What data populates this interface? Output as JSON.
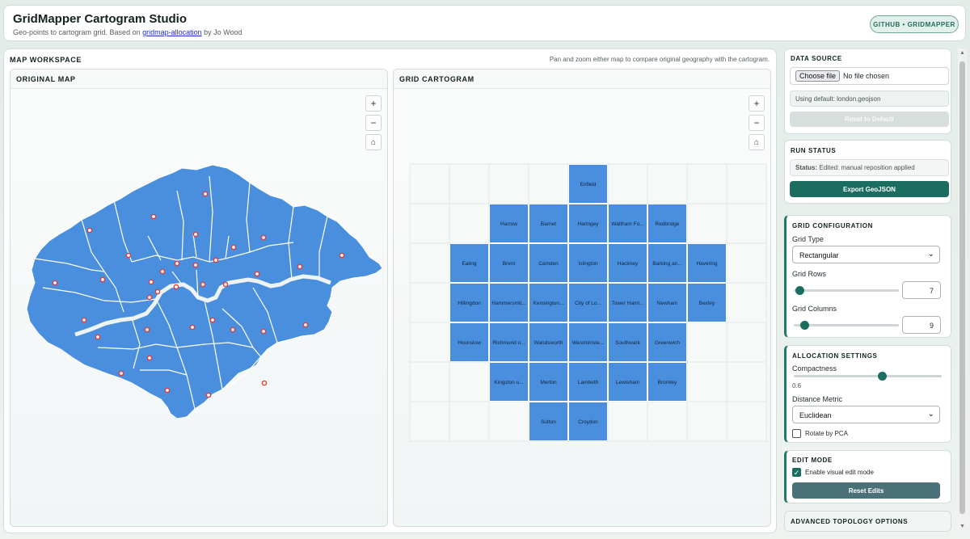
{
  "header": {
    "title": "GridMapper Cartogram Studio",
    "subtitle_prefix": "Geo-points to cartogram grid. Based on",
    "subtitle_link": "gridmap-allocation",
    "subtitle_suffix": "by Jo Wood",
    "github_button": "GITHUB • GRIDMAPPER"
  },
  "workspace": {
    "title": "MAP WORKSPACE",
    "hint": "Pan and zoom either map to compare original geography with the cartogram.",
    "original_panel_title": "ORIGINAL MAP",
    "grid_panel_title": "GRID CARTOGRAM",
    "zoom_in": "+",
    "zoom_out": "−",
    "reset_view": "⌂"
  },
  "colors": {
    "region_fill": "#4a8fde",
    "region_stroke": "#ffffff",
    "point_fill": "#ffffff",
    "point_ring": "#e03b3b",
    "cell_fill": "#4a8fde",
    "empty_cell": "#f7f9f9",
    "accent": "#1b6e5f"
  },
  "grid": {
    "rows": 7,
    "cols": 9,
    "cells": [
      {
        "row": 0,
        "col": 4,
        "label": "Enfield"
      },
      {
        "row": 1,
        "col": 2,
        "label": "Harrow"
      },
      {
        "row": 1,
        "col": 3,
        "label": "Barnet"
      },
      {
        "row": 1,
        "col": 4,
        "label": "Haringey"
      },
      {
        "row": 1,
        "col": 5,
        "label": "Waltham Fo..."
      },
      {
        "row": 1,
        "col": 6,
        "label": "Redbridge"
      },
      {
        "row": 2,
        "col": 1,
        "label": "Ealing"
      },
      {
        "row": 2,
        "col": 2,
        "label": "Brent"
      },
      {
        "row": 2,
        "col": 3,
        "label": "Camden"
      },
      {
        "row": 2,
        "col": 4,
        "label": "Islington"
      },
      {
        "row": 2,
        "col": 5,
        "label": "Hackney"
      },
      {
        "row": 2,
        "col": 6,
        "label": "Barking an..."
      },
      {
        "row": 2,
        "col": 7,
        "label": "Havering"
      },
      {
        "row": 3,
        "col": 1,
        "label": "Hillingdon"
      },
      {
        "row": 3,
        "col": 2,
        "label": "Hammersmit..."
      },
      {
        "row": 3,
        "col": 3,
        "label": "Kensington..."
      },
      {
        "row": 3,
        "col": 4,
        "label": "City of Lo..."
      },
      {
        "row": 3,
        "col": 5,
        "label": "Tower Haml..."
      },
      {
        "row": 3,
        "col": 6,
        "label": "Newham"
      },
      {
        "row": 3,
        "col": 7,
        "label": "Bexley"
      },
      {
        "row": 4,
        "col": 1,
        "label": "Hounslow"
      },
      {
        "row": 4,
        "col": 2,
        "label": "Richmond u..."
      },
      {
        "row": 4,
        "col": 3,
        "label": "Wandsworth"
      },
      {
        "row": 4,
        "col": 4,
        "label": "Westminste..."
      },
      {
        "row": 4,
        "col": 5,
        "label": "Southwark"
      },
      {
        "row": 4,
        "col": 6,
        "label": "Greenwich"
      },
      {
        "row": 5,
        "col": 2,
        "label": "Kingston u..."
      },
      {
        "row": 5,
        "col": 3,
        "label": "Merton"
      },
      {
        "row": 5,
        "col": 4,
        "label": "Lambeth"
      },
      {
        "row": 5,
        "col": 5,
        "label": "Lewisham"
      },
      {
        "row": 5,
        "col": 6,
        "label": "Bromley"
      },
      {
        "row": 6,
        "col": 3,
        "label": "Sutton"
      },
      {
        "row": 6,
        "col": 4,
        "label": "Croydon"
      }
    ]
  },
  "sidebar": {
    "data_source": {
      "title": "DATA SOURCE",
      "file_button": "Choose file",
      "file_status": "No file chosen",
      "default_note": "Using default: london.geojson",
      "reset_button": "Reset to Default"
    },
    "run_status": {
      "title": "RUN STATUS",
      "status_label": "Status:",
      "status_value": "Edited: manual reposition applied",
      "export_button": "Export GeoJSON"
    },
    "grid_config": {
      "title": "GRID CONFIGURATION",
      "grid_type_label": "Grid Type",
      "grid_type_value": "Rectangular",
      "rows_label": "Grid Rows",
      "rows_value": "7",
      "rows_fraction": 0.06,
      "cols_label": "Grid Columns",
      "cols_value": "9",
      "cols_fraction": 0.1
    },
    "allocation": {
      "title": "ALLOCATION SETTINGS",
      "compactness_label": "Compactness",
      "compactness_value": "0.6",
      "compactness_fraction": 0.6,
      "distance_label": "Distance Metric",
      "distance_value": "Euclidean",
      "rotate_label": "Rotate by PCA",
      "rotate_checked": false
    },
    "edit_mode": {
      "title": "EDIT MODE",
      "enable_label": "Enable visual edit mode",
      "enable_checked": true,
      "reset_button": "Reset Edits"
    },
    "advanced": {
      "title": "ADVANCED TOPOLOGY OPTIONS"
    }
  }
}
